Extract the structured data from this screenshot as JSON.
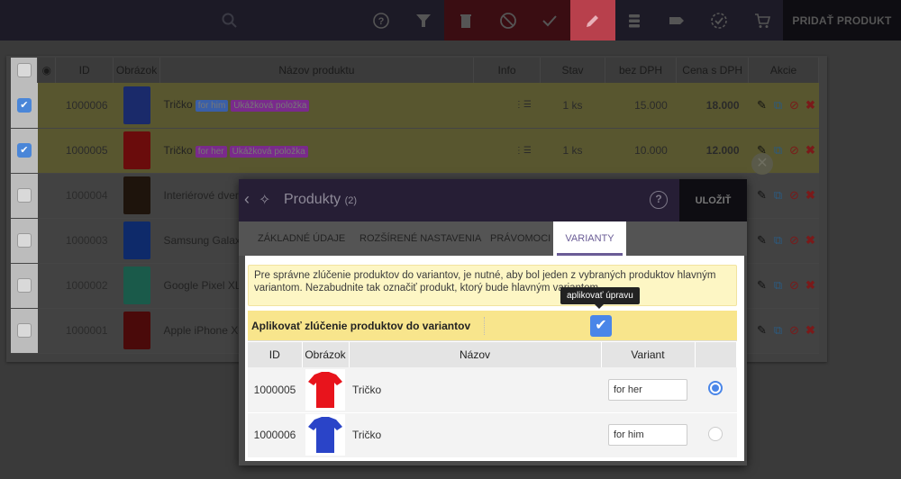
{
  "toolbar": {
    "search_icon": "search-icon",
    "buttons": [
      {
        "name": "help",
        "icon": "?"
      },
      {
        "name": "filter",
        "icon": "filter"
      },
      {
        "name": "delete",
        "icon": "trash"
      },
      {
        "name": "disable",
        "icon": "ban"
      },
      {
        "name": "approve",
        "icon": "check"
      },
      {
        "name": "edit",
        "icon": "pencil"
      },
      {
        "name": "list",
        "icon": "list"
      },
      {
        "name": "tag",
        "icon": "tag"
      },
      {
        "name": "verified",
        "icon": "badge-check"
      },
      {
        "name": "cart",
        "icon": "cart"
      }
    ],
    "add_product_label": "PRIDAŤ PRODUKT"
  },
  "table": {
    "headers": {
      "id": "ID",
      "image": "Obrázok",
      "name": "Názov produktu",
      "info": "Info",
      "status": "Stav",
      "price_no_vat": "bez DPH",
      "price_vat": "Cena s DPH",
      "actions": "Akcie"
    },
    "rows": [
      {
        "id": "1000006",
        "name": "Tričko",
        "badge1": "for him",
        "badge1_color": "#3a5fa8",
        "badge2": "Ukážková položka",
        "badge2_color": "#7a2a8c",
        "stock": "1 ks",
        "price_no_vat": "15.000",
        "price_vat": "18.000",
        "checked": true,
        "image_color": "#1a2a6a"
      },
      {
        "id": "1000005",
        "name": "Tričko",
        "badge1": "for her",
        "badge1_color": "#7a2a8c",
        "badge2": "Ukážková položka",
        "badge2_color": "#7a2a8c",
        "stock": "1 ks",
        "price_no_vat": "10.000",
        "price_vat": "12.000",
        "checked": true,
        "image_color": "#6a0c0c"
      },
      {
        "id": "1000004",
        "name": "Interiérové dvere",
        "checked": false,
        "image_color": "#1e140c"
      },
      {
        "id": "1000003",
        "name": "Samsung Galaxy",
        "checked": false,
        "image_color": "#0e2a6a"
      },
      {
        "id": "1000002",
        "name": "Google Pixel XL",
        "checked": false,
        "image_color": "#1a5a4a"
      },
      {
        "id": "1000001",
        "name": "Apple iPhone XC",
        "checked": false,
        "image_color": "#4a0a0a"
      }
    ]
  },
  "modal": {
    "title": "Produkty",
    "count": "(2)",
    "help": "?",
    "save_label": "ULOŽIŤ",
    "tabs": [
      "ZÁKLADNÉ ÚDAJE",
      "ROZŠÍRENÉ NASTAVENIA",
      "PRÁVOMOCI",
      "VARIANTY"
    ],
    "active_tab": "VARIANTY",
    "info_text": "Pre správne zlúčenie produktov do variantov, je nutné, aby bol jeden z vybraných produktov hlavným variantom. Nezabudnite tak označiť produkt, ktorý bude hlavným variantom.",
    "apply_label": "Aplikovať zlúčenie produktov do variantov",
    "apply_checked": true,
    "tooltip": "aplikovať úpravu",
    "variant_table": {
      "headers": {
        "id": "ID",
        "image": "Obrázok",
        "name": "Názov",
        "variant": "Variant"
      },
      "rows": [
        {
          "id": "1000005",
          "name": "Tričko",
          "variant": "for her",
          "main": true,
          "image_color": "#e8141c"
        },
        {
          "id": "1000006",
          "name": "Tričko",
          "variant": "for him",
          "main": false,
          "image_color": "#2a44c8"
        }
      ]
    }
  },
  "colors": {
    "accent": "#6a5c96",
    "checkbox": "#4a86e8",
    "active_toolbar": "#b8404c"
  }
}
